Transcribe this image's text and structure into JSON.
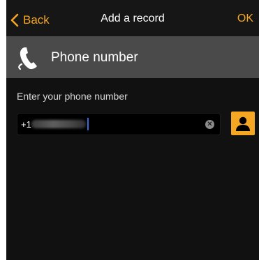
{
  "nav": {
    "back_label": "Back",
    "title": "Add a record",
    "ok_label": "OK"
  },
  "section": {
    "title": "Phone number",
    "icon": "phone-handset-icon"
  },
  "form": {
    "prompt": "Enter your phone number",
    "phone_prefix": "+1",
    "clear_icon": "clear-icon",
    "contacts_icon": "contact-person-icon"
  },
  "colors": {
    "accent": "#f5a623",
    "background": "#111111",
    "section_header": "#4a4a4a",
    "caret": "#3b6bd8"
  }
}
